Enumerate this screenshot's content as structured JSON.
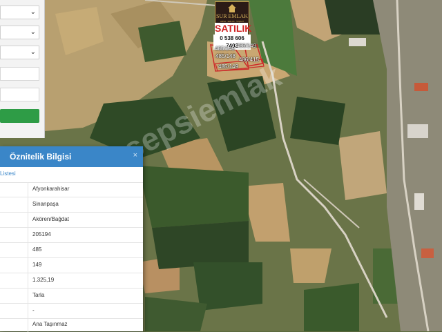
{
  "dialog": {
    "title": "Öznitelik Bilgisi",
    "close": "×",
    "subtitle": "Listesi",
    "values": [
      "Afyonkarahisar",
      "Sinanpaşa",
      "Akören/Bağdat",
      "205194",
      "485",
      "149",
      "1.325,19",
      "Tarla",
      "-",
      "Ana Taşınmaz"
    ]
  },
  "banner": {
    "brand": "SUR EMLAK",
    "brand_small": "ARSA · EMLAK · İNŞAAT",
    "sale_text": "SATILIK",
    "phone": "0 538 606 7403",
    "parcel_labels": [
      "485/149",
      "485/148",
      "486/149",
      "486/415",
      "485/149"
    ]
  },
  "watermark": "sepsiemlak",
  "colors": {
    "header": "#3a86c8",
    "button": "#2e9c46",
    "sale": "#d02222",
    "parcel_outline": "#cc2a2a"
  }
}
